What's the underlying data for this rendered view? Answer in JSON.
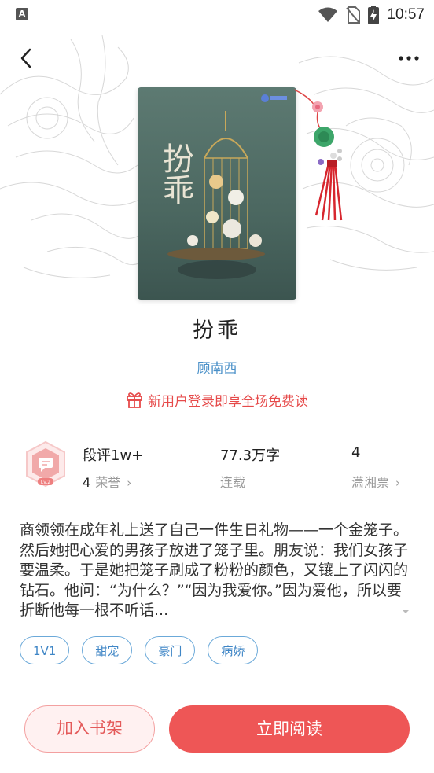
{
  "status_bar": {
    "time": "10:57",
    "app_icon_letter": "A",
    "icons": [
      "wifi-icon",
      "no-sim-icon",
      "battery-charging-icon"
    ]
  },
  "nav": {
    "back_icon": "chevron-left-icon",
    "more_icon": "more-horizontal-icon"
  },
  "cover": {
    "title_art": "扮乖",
    "decoration": "birdcage-with-flowers"
  },
  "book": {
    "title": "扮乖",
    "author": "顾南西"
  },
  "promo": {
    "icon": "gift-icon",
    "text": "新用户登录即享全场免费读"
  },
  "stats": {
    "badge_level": "Lv.2",
    "review_count": "段评1w+",
    "honor_count": "4",
    "honor_label": "荣誉",
    "word_count": "77.3万字",
    "status": "连载",
    "ticket_count": "4",
    "ticket_label": "潇湘票"
  },
  "synopsis": {
    "text": "商领领在成年礼上送了自己一件生日礼物——一个金笼子。然后她把心爱的男孩子放进了笼子里。朋友说：我们女孩子要温柔。于是她把笼子刷成了粉粉的颜色，又镶上了闪闪的钻石。他问：“为什么？”“因为我爱你。”因为爱他，所以要折断他每一根不听话...",
    "expand_icon": "chevron-down-icon"
  },
  "tags": [
    "1V1",
    "甜宠",
    "豪门",
    "病娇"
  ],
  "actions": {
    "add_to_shelf": "加入书架",
    "read_now": "立即阅读"
  },
  "colors": {
    "accent_red": "#ee5656",
    "link_blue": "#4a90c8",
    "tag_blue": "#3f86c6",
    "promo_red": "#e64a4a"
  }
}
